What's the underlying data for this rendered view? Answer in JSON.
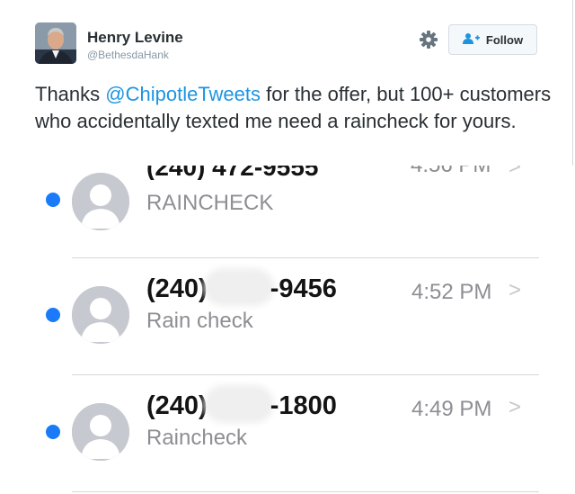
{
  "tweet": {
    "author_name": "Henry Levine",
    "author_handle": "@BethesdaHank",
    "follow_label": "Follow",
    "text_before": "Thanks ",
    "mention": "@ChipotleTweets",
    "text_after": " for the offer, but 100+ customers who accidentally texted me need a raincheck for yours."
  },
  "messages": {
    "threads": [
      {
        "phone_prefix": "",
        "phone_suffix": "",
        "time": "",
        "preview": "RAINCHECK"
      },
      {
        "phone_prefix": "(240)",
        "phone_suffix": "-9456",
        "time": "4:52 PM",
        "preview": "Rain check"
      },
      {
        "phone_prefix": "(240)",
        "phone_suffix": "-1800",
        "time": "4:49 PM",
        "preview": "Raincheck"
      }
    ]
  },
  "colors": {
    "mention": "#1b95e0",
    "unread_dot": "#1a7af8",
    "avatar_gray": "#c6c9cf"
  },
  "icons": [
    "gear-icon",
    "follow-person-icon",
    "contact-avatar-icon",
    "chevron-right-icon"
  ]
}
